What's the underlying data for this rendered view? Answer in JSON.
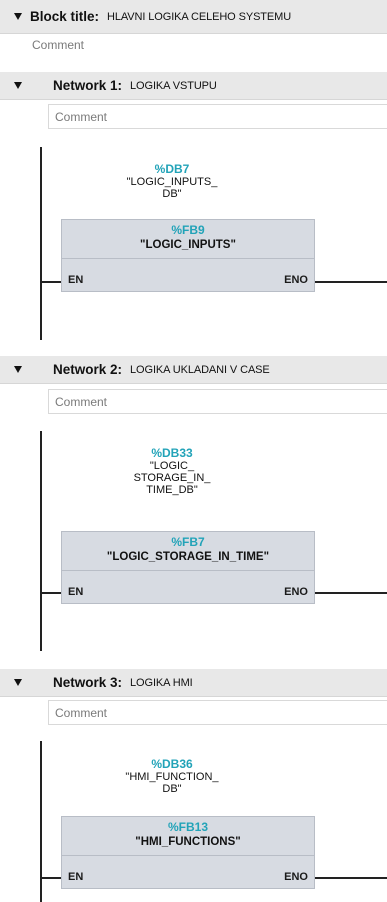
{
  "block": {
    "title_label": "Block title:",
    "title_value": "HLAVNI LOGIKA CELEHO SYSTEMU",
    "comment": "Comment"
  },
  "networks": [
    {
      "label": "Network 1:",
      "title": "LOGIKA VSTUPU",
      "comment": "Comment",
      "db_address": "%DB7",
      "db_name": "\"LOGIC_INPUTS_\nDB\"",
      "fb_address": "%FB9",
      "fb_name": "\"LOGIC_INPUTS\"",
      "en": "EN",
      "eno": "ENO"
    },
    {
      "label": "Network 2:",
      "title": "LOGIKA UKLADANI V CASE",
      "comment": "Comment",
      "db_address": "%DB33",
      "db_name": "\"LOGIC_\nSTORAGE_IN_\nTIME_DB\"",
      "fb_address": "%FB7",
      "fb_name": "\"LOGIC_STORAGE_IN_TIME\"",
      "en": "EN",
      "eno": "ENO"
    },
    {
      "label": "Network 3:",
      "title": "LOGIKA HMI",
      "comment": "Comment",
      "db_address": "%DB36",
      "db_name": "\"HMI_FUNCTION_\nDB\"",
      "fb_address": "%FB13",
      "fb_name": "\"HMI_FUNCTIONS\"",
      "en": "EN",
      "eno": "ENO"
    }
  ],
  "icons": {
    "collapse": "triangle-down-icon"
  }
}
